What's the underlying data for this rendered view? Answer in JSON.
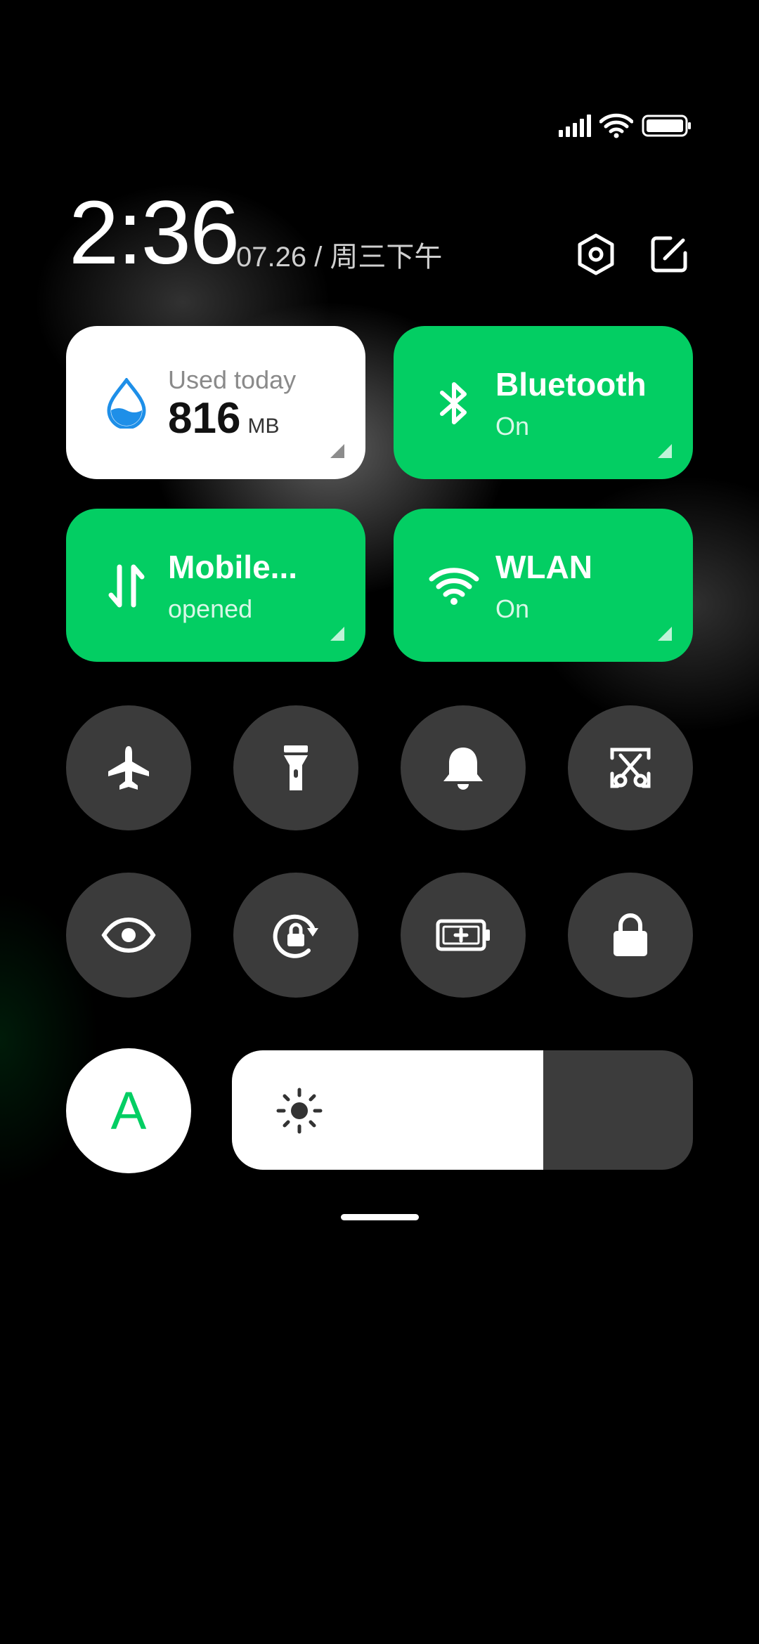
{
  "status_bar": {
    "icons": [
      "signal-icon",
      "wifi-icon",
      "battery-icon"
    ]
  },
  "header": {
    "time": "2:36",
    "date": "07.26 / 周三下午"
  },
  "tiles": {
    "data_usage": {
      "label": "Used today",
      "value": "816",
      "unit": "MB"
    },
    "bluetooth": {
      "title": "Bluetooth",
      "state": "On"
    },
    "mobile_data": {
      "title": "Mobile...",
      "state": "opened"
    },
    "wlan": {
      "title": "WLAN",
      "state": "On"
    }
  },
  "toggles_row1": [
    "airplane-mode",
    "flashlight",
    "ringer",
    "screenshot"
  ],
  "toggles_row2": [
    "reading-mode",
    "rotation-lock",
    "battery-saver",
    "lock-screen"
  ],
  "auto_brightness": {
    "label": "A"
  },
  "brightness": {
    "level": 0.675
  },
  "colors": {
    "accent_green": "#03CE63",
    "tile_white": "#FFFFFF",
    "button_gray": "#3B3B3B"
  }
}
